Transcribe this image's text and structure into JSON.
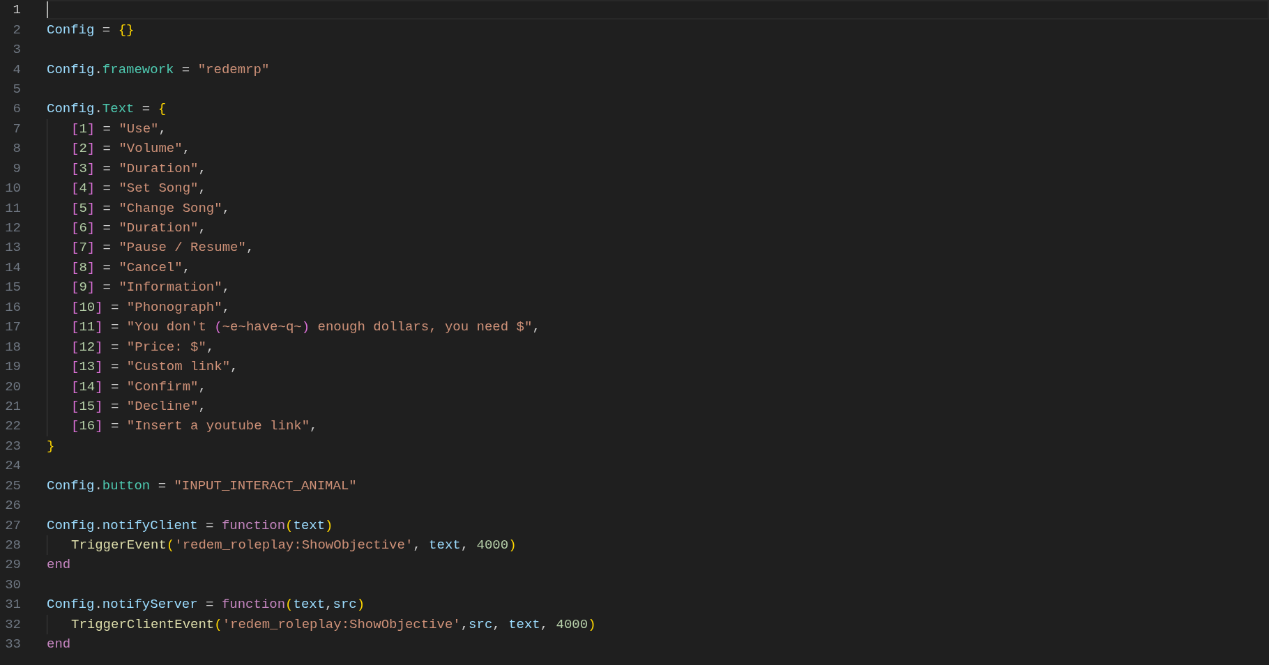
{
  "editor": {
    "lines": [
      {
        "number": "1",
        "current": true
      },
      {
        "number": "2",
        "current": false,
        "indented": false,
        "tokens": [
          {
            "kind": "var",
            "text": "Config"
          },
          {
            "kind": "op",
            "text": " = "
          },
          {
            "kind": "brace",
            "text": "{}"
          }
        ]
      },
      {
        "number": "3",
        "current": false
      },
      {
        "number": "4",
        "current": false,
        "indented": false,
        "tokens": [
          {
            "kind": "var",
            "text": "Config"
          },
          {
            "kind": "op",
            "text": "."
          },
          {
            "kind": "prop",
            "text": "framework"
          },
          {
            "kind": "op",
            "text": " = "
          },
          {
            "kind": "str",
            "text": "\"redemrp\""
          }
        ]
      },
      {
        "number": "5",
        "current": false
      },
      {
        "number": "6",
        "current": false,
        "indented": false,
        "tokens": [
          {
            "kind": "var",
            "text": "Config"
          },
          {
            "kind": "op",
            "text": "."
          },
          {
            "kind": "prop",
            "text": "Text"
          },
          {
            "kind": "op",
            "text": " = "
          },
          {
            "kind": "brace",
            "text": "{"
          }
        ]
      },
      {
        "number": "7",
        "current": false,
        "indented": true,
        "tokens": [
          {
            "kind": "bracket",
            "text": "["
          },
          {
            "kind": "num",
            "text": "1"
          },
          {
            "kind": "bracket",
            "text": "]"
          },
          {
            "kind": "op",
            "text": " = "
          },
          {
            "kind": "str",
            "text": "\"Use\""
          },
          {
            "kind": "op",
            "text": ","
          }
        ]
      },
      {
        "number": "8",
        "current": false,
        "indented": true,
        "tokens": [
          {
            "kind": "bracket",
            "text": "["
          },
          {
            "kind": "num",
            "text": "2"
          },
          {
            "kind": "bracket",
            "text": "]"
          },
          {
            "kind": "op",
            "text": " = "
          },
          {
            "kind": "str",
            "text": "\"Volume\""
          },
          {
            "kind": "op",
            "text": ","
          }
        ]
      },
      {
        "number": "9",
        "current": false,
        "indented": true,
        "tokens": [
          {
            "kind": "bracket",
            "text": "["
          },
          {
            "kind": "num",
            "text": "3"
          },
          {
            "kind": "bracket",
            "text": "]"
          },
          {
            "kind": "op",
            "text": " = "
          },
          {
            "kind": "str",
            "text": "\"Duration\""
          },
          {
            "kind": "op",
            "text": ","
          }
        ]
      },
      {
        "number": "10",
        "current": false,
        "indented": true,
        "tokens": [
          {
            "kind": "bracket",
            "text": "["
          },
          {
            "kind": "num",
            "text": "4"
          },
          {
            "kind": "bracket",
            "text": "]"
          },
          {
            "kind": "op",
            "text": " = "
          },
          {
            "kind": "str",
            "text": "\"Set Song\""
          },
          {
            "kind": "op",
            "text": ","
          }
        ]
      },
      {
        "number": "11",
        "current": false,
        "indented": true,
        "tokens": [
          {
            "kind": "bracket",
            "text": "["
          },
          {
            "kind": "num",
            "text": "5"
          },
          {
            "kind": "bracket",
            "text": "]"
          },
          {
            "kind": "op",
            "text": " = "
          },
          {
            "kind": "str",
            "text": "\"Change Song\""
          },
          {
            "kind": "op",
            "text": ","
          }
        ]
      },
      {
        "number": "12",
        "current": false,
        "indented": true,
        "tokens": [
          {
            "kind": "bracket",
            "text": "["
          },
          {
            "kind": "num",
            "text": "6"
          },
          {
            "kind": "bracket",
            "text": "]"
          },
          {
            "kind": "op",
            "text": " = "
          },
          {
            "kind": "str",
            "text": "\"Duration\""
          },
          {
            "kind": "op",
            "text": ","
          }
        ]
      },
      {
        "number": "13",
        "current": false,
        "indented": true,
        "tokens": [
          {
            "kind": "bracket",
            "text": "["
          },
          {
            "kind": "num",
            "text": "7"
          },
          {
            "kind": "bracket",
            "text": "]"
          },
          {
            "kind": "op",
            "text": " = "
          },
          {
            "kind": "str",
            "text": "\"Pause / Resume\""
          },
          {
            "kind": "op",
            "text": ","
          }
        ]
      },
      {
        "number": "14",
        "current": false,
        "indented": true,
        "tokens": [
          {
            "kind": "bracket",
            "text": "["
          },
          {
            "kind": "num",
            "text": "8"
          },
          {
            "kind": "bracket",
            "text": "]"
          },
          {
            "kind": "op",
            "text": " = "
          },
          {
            "kind": "str",
            "text": "\"Cancel\""
          },
          {
            "kind": "op",
            "text": ","
          }
        ]
      },
      {
        "number": "15",
        "current": false,
        "indented": true,
        "tokens": [
          {
            "kind": "bracket",
            "text": "["
          },
          {
            "kind": "num",
            "text": "9"
          },
          {
            "kind": "bracket",
            "text": "]"
          },
          {
            "kind": "op",
            "text": " = "
          },
          {
            "kind": "str",
            "text": "\"Information\""
          },
          {
            "kind": "op",
            "text": ","
          }
        ]
      },
      {
        "number": "16",
        "current": false,
        "indented": true,
        "tokens": [
          {
            "kind": "bracket",
            "text": "["
          },
          {
            "kind": "num",
            "text": "10"
          },
          {
            "kind": "bracket",
            "text": "]"
          },
          {
            "kind": "op",
            "text": " = "
          },
          {
            "kind": "str",
            "text": "\"Phonograph\""
          },
          {
            "kind": "op",
            "text": ","
          }
        ]
      },
      {
        "number": "17",
        "current": false,
        "indented": true,
        "tokens": [
          {
            "kind": "bracket",
            "text": "["
          },
          {
            "kind": "num",
            "text": "11"
          },
          {
            "kind": "bracket",
            "text": "]"
          },
          {
            "kind": "op",
            "text": " = "
          },
          {
            "kind": "str",
            "text": "\"You don't "
          },
          {
            "kind": "bracket",
            "text": "("
          },
          {
            "kind": "str",
            "text": "~e~have~q~"
          },
          {
            "kind": "bracket",
            "text": ")"
          },
          {
            "kind": "str",
            "text": " enough dollars, you need $\""
          },
          {
            "kind": "op",
            "text": ","
          }
        ]
      },
      {
        "number": "18",
        "current": false,
        "indented": true,
        "tokens": [
          {
            "kind": "bracket",
            "text": "["
          },
          {
            "kind": "num",
            "text": "12"
          },
          {
            "kind": "bracket",
            "text": "]"
          },
          {
            "kind": "op",
            "text": " = "
          },
          {
            "kind": "str",
            "text": "\"Price: $\""
          },
          {
            "kind": "op",
            "text": ","
          }
        ]
      },
      {
        "number": "19",
        "current": false,
        "indented": true,
        "tokens": [
          {
            "kind": "bracket",
            "text": "["
          },
          {
            "kind": "num",
            "text": "13"
          },
          {
            "kind": "bracket",
            "text": "]"
          },
          {
            "kind": "op",
            "text": " = "
          },
          {
            "kind": "str",
            "text": "\"Custom link\""
          },
          {
            "kind": "op",
            "text": ","
          }
        ]
      },
      {
        "number": "20",
        "current": false,
        "indented": true,
        "tokens": [
          {
            "kind": "bracket",
            "text": "["
          },
          {
            "kind": "num",
            "text": "14"
          },
          {
            "kind": "bracket",
            "text": "]"
          },
          {
            "kind": "op",
            "text": " = "
          },
          {
            "kind": "str",
            "text": "\"Confirm\""
          },
          {
            "kind": "op",
            "text": ","
          }
        ]
      },
      {
        "number": "21",
        "current": false,
        "indented": true,
        "tokens": [
          {
            "kind": "bracket",
            "text": "["
          },
          {
            "kind": "num",
            "text": "15"
          },
          {
            "kind": "bracket",
            "text": "]"
          },
          {
            "kind": "op",
            "text": " = "
          },
          {
            "kind": "str",
            "text": "\"Decline\""
          },
          {
            "kind": "op",
            "text": ","
          }
        ]
      },
      {
        "number": "22",
        "current": false,
        "indented": true,
        "tokens": [
          {
            "kind": "bracket",
            "text": "["
          },
          {
            "kind": "num",
            "text": "16"
          },
          {
            "kind": "bracket",
            "text": "]"
          },
          {
            "kind": "op",
            "text": " = "
          },
          {
            "kind": "str",
            "text": "\"Insert a youtube link\""
          },
          {
            "kind": "op",
            "text": ","
          }
        ]
      },
      {
        "number": "23",
        "current": false,
        "indented": false,
        "tokens": [
          {
            "kind": "brace",
            "text": "}"
          }
        ]
      },
      {
        "number": "24",
        "current": false
      },
      {
        "number": "25",
        "current": false,
        "indented": false,
        "tokens": [
          {
            "kind": "var",
            "text": "Config"
          },
          {
            "kind": "op",
            "text": "."
          },
          {
            "kind": "prop",
            "text": "button"
          },
          {
            "kind": "op",
            "text": " = "
          },
          {
            "kind": "str",
            "text": "\"INPUT_INTERACT_ANIMAL\""
          }
        ]
      },
      {
        "number": "26",
        "current": false
      },
      {
        "number": "27",
        "current": false,
        "indented": false,
        "tokens": [
          {
            "kind": "var",
            "text": "Config"
          },
          {
            "kind": "op",
            "text": "."
          },
          {
            "kind": "var",
            "text": "notifyClient"
          },
          {
            "kind": "op",
            "text": " = "
          },
          {
            "kind": "kw",
            "text": "function"
          },
          {
            "kind": "brace",
            "text": "("
          },
          {
            "kind": "var",
            "text": "text"
          },
          {
            "kind": "brace",
            "text": ")"
          }
        ]
      },
      {
        "number": "28",
        "current": false,
        "indented": true,
        "tokens": [
          {
            "kind": "fn",
            "text": "TriggerEvent"
          },
          {
            "kind": "brace",
            "text": "("
          },
          {
            "kind": "str",
            "text": "'redem_roleplay:ShowObjective'"
          },
          {
            "kind": "op",
            "text": ", "
          },
          {
            "kind": "var",
            "text": "text"
          },
          {
            "kind": "op",
            "text": ", "
          },
          {
            "kind": "num",
            "text": "4000"
          },
          {
            "kind": "brace",
            "text": ")"
          }
        ]
      },
      {
        "number": "29",
        "current": false,
        "indented": false,
        "tokens": [
          {
            "kind": "kw",
            "text": "end"
          }
        ]
      },
      {
        "number": "30",
        "current": false
      },
      {
        "number": "31",
        "current": false,
        "indented": false,
        "tokens": [
          {
            "kind": "var",
            "text": "Config"
          },
          {
            "kind": "op",
            "text": "."
          },
          {
            "kind": "var",
            "text": "notifyServer"
          },
          {
            "kind": "op",
            "text": " = "
          },
          {
            "kind": "kw",
            "text": "function"
          },
          {
            "kind": "brace",
            "text": "("
          },
          {
            "kind": "var",
            "text": "text"
          },
          {
            "kind": "op",
            "text": ","
          },
          {
            "kind": "var",
            "text": "src"
          },
          {
            "kind": "brace",
            "text": ")"
          }
        ]
      },
      {
        "number": "32",
        "current": false,
        "indented": true,
        "tokens": [
          {
            "kind": "fn",
            "text": "TriggerClientEvent"
          },
          {
            "kind": "brace",
            "text": "("
          },
          {
            "kind": "str",
            "text": "'redem_roleplay:ShowObjective'"
          },
          {
            "kind": "op",
            "text": ","
          },
          {
            "kind": "var",
            "text": "src"
          },
          {
            "kind": "op",
            "text": ", "
          },
          {
            "kind": "var",
            "text": "text"
          },
          {
            "kind": "op",
            "text": ", "
          },
          {
            "kind": "num",
            "text": "4000"
          },
          {
            "kind": "brace",
            "text": ")"
          }
        ]
      },
      {
        "number": "33",
        "current": false,
        "indented": false,
        "tokens": [
          {
            "kind": "kw",
            "text": "end"
          }
        ]
      }
    ]
  }
}
